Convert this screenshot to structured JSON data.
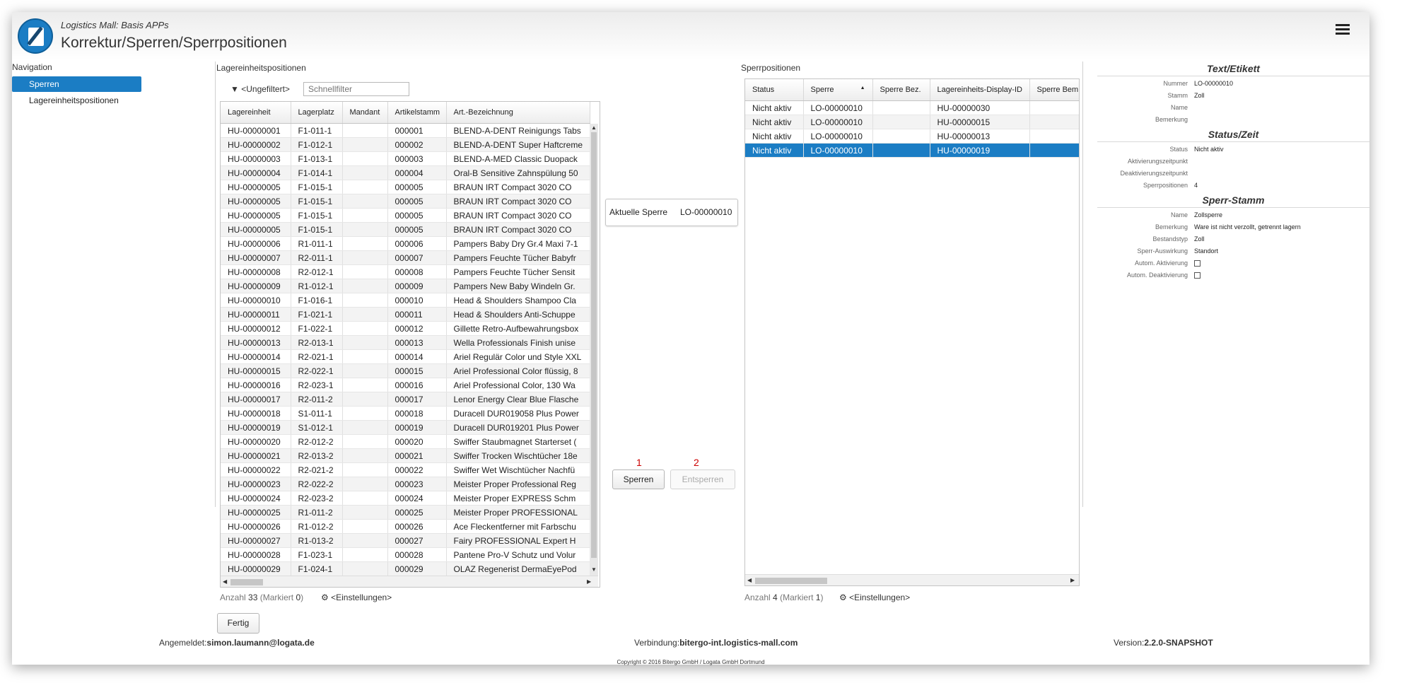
{
  "header": {
    "app_name": "Logistics Mall: Basis APPs",
    "page_title": "Korrektur/Sperren/Sperrpositionen"
  },
  "navigation": {
    "label": "Navigation",
    "items": [
      {
        "label": "Sperren",
        "active": true
      },
      {
        "label": "Lagereinheitspositionen",
        "active": false
      }
    ]
  },
  "left_panel": {
    "title": "Lagereinheitspositionen",
    "filter_label": "<Ungefiltert>",
    "quickfilter_placeholder": "Schnellfilter",
    "columns": [
      "Lagereinheit",
      "Lagerplatz",
      "Mandant",
      "Artikelstamm",
      "Art.-Bezeichnung"
    ],
    "rows": [
      [
        "HU-00000001",
        "F1-011-1",
        "",
        "000001",
        "BLEND-A-DENT Reinigungs Tabs"
      ],
      [
        "HU-00000002",
        "F1-012-1",
        "",
        "000002",
        "BLEND-A-DENT Super Haftcreme"
      ],
      [
        "HU-00000003",
        "F1-013-1",
        "",
        "000003",
        "BLEND-A-MED Classic Duopack"
      ],
      [
        "HU-00000004",
        "F1-014-1",
        "",
        "000004",
        "Oral-B Sensitive Zahnspülung 50"
      ],
      [
        "HU-00000005",
        "F1-015-1",
        "",
        "000005",
        "BRAUN IRT Compact 3020 CO"
      ],
      [
        "HU-00000005",
        "F1-015-1",
        "",
        "000005",
        "BRAUN IRT Compact 3020 CO"
      ],
      [
        "HU-00000005",
        "F1-015-1",
        "",
        "000005",
        "BRAUN IRT Compact 3020 CO"
      ],
      [
        "HU-00000005",
        "F1-015-1",
        "",
        "000005",
        "BRAUN IRT Compact 3020 CO"
      ],
      [
        "HU-00000006",
        "R1-011-1",
        "",
        "000006",
        "Pampers Baby Dry Gr.4 Maxi 7-1"
      ],
      [
        "HU-00000007",
        "R2-011-1",
        "",
        "000007",
        "Pampers Feuchte Tücher Babyfr"
      ],
      [
        "HU-00000008",
        "R2-012-1",
        "",
        "000008",
        "Pampers Feuchte Tücher Sensit"
      ],
      [
        "HU-00000009",
        "R1-012-1",
        "",
        "000009",
        "Pampers New Baby Windeln Gr."
      ],
      [
        "HU-00000010",
        "F1-016-1",
        "",
        "000010",
        "Head & Shoulders Shampoo Cla"
      ],
      [
        "HU-00000011",
        "F1-021-1",
        "",
        "000011",
        "Head & Shoulders Anti-Schuppe"
      ],
      [
        "HU-00000012",
        "F1-022-1",
        "",
        "000012",
        "Gillette Retro-Aufbewahrungsbox"
      ],
      [
        "HU-00000013",
        "R2-013-1",
        "",
        "000013",
        "Wella Professionals Finish unise"
      ],
      [
        "HU-00000014",
        "R2-021-1",
        "",
        "000014",
        "Ariel Regulär Color und Style XXL"
      ],
      [
        "HU-00000015",
        "R2-022-1",
        "",
        "000015",
        "Ariel Professional Color flüssig, 8"
      ],
      [
        "HU-00000016",
        "R2-023-1",
        "",
        "000016",
        "Ariel Professional Color, 130 Wa"
      ],
      [
        "HU-00000017",
        "R2-011-2",
        "",
        "000017",
        "Lenor Energy Clear Blue Flasche"
      ],
      [
        "HU-00000018",
        "S1-011-1",
        "",
        "000018",
        "Duracell DUR019058 Plus Power"
      ],
      [
        "HU-00000019",
        "S1-012-1",
        "",
        "000019",
        "Duracell DUR019201 Plus Power"
      ],
      [
        "HU-00000020",
        "R2-012-2",
        "",
        "000020",
        "Swiffer Staubmagnet Starterset ("
      ],
      [
        "HU-00000021",
        "R2-013-2",
        "",
        "000021",
        "Swiffer Trocken Wischtücher 18e"
      ],
      [
        "HU-00000022",
        "R2-021-2",
        "",
        "000022",
        "Swiffer Wet Wischtücher Nachfü"
      ],
      [
        "HU-00000023",
        "R2-022-2",
        "",
        "000023",
        "Meister Proper Professional Reg"
      ],
      [
        "HU-00000024",
        "R2-023-2",
        "",
        "000024",
        "Meister Proper EXPRESS Schm"
      ],
      [
        "HU-00000025",
        "R1-011-2",
        "",
        "000025",
        "Meister Proper PROFESSIONAL"
      ],
      [
        "HU-00000026",
        "R1-012-2",
        "",
        "000026",
        "Ace Fleckentferner mit Farbschu"
      ],
      [
        "HU-00000027",
        "R1-013-2",
        "",
        "000027",
        "Fairy PROFESSIONAL Expert H"
      ],
      [
        "HU-00000028",
        "F1-023-1",
        "",
        "000028",
        "Pantene Pro-V Schutz und Volur"
      ],
      [
        "HU-00000029",
        "F1-024-1",
        "",
        "000029",
        "OLAZ Regenerist DermaEyePod"
      ]
    ],
    "summary": {
      "count_label": "Anzahl",
      "count": "33",
      "marked_label": "(Markiert",
      "marked": "0",
      "close": ")"
    },
    "settings_label": "<Einstellungen>"
  },
  "middle": {
    "current_label": "Aktuelle Sperre",
    "current_value": "LO-00000010",
    "lock_number": "1",
    "unlock_number": "2",
    "lock_button": "Sperren",
    "unlock_button": "Entsperren"
  },
  "right_panel": {
    "title": "Sperrpositionen",
    "columns": [
      "Status",
      "Sperre",
      "Sperre Bez.",
      "Lagereinheits-Display-ID",
      "Sperre Bem."
    ],
    "sort_indicator": "▲",
    "rows": [
      [
        "Nicht aktiv",
        "LO-00000010",
        "",
        "HU-00000030",
        ""
      ],
      [
        "Nicht aktiv",
        "LO-00000010",
        "",
        "HU-00000015",
        ""
      ],
      [
        "Nicht aktiv",
        "LO-00000010",
        "",
        "HU-00000013",
        ""
      ],
      [
        "Nicht aktiv",
        "LO-00000010",
        "",
        "HU-00000019",
        ""
      ]
    ],
    "selected_row": 3,
    "summary": {
      "count_label": "Anzahl",
      "count": "4",
      "marked_label": "(Markiert",
      "marked": "1",
      "close": ")"
    },
    "settings_label": "<Einstellungen>"
  },
  "properties": {
    "sections": [
      {
        "title": "Text/Etikett",
        "rows": [
          {
            "k": "Nummer",
            "v": "LO-00000010"
          },
          {
            "k": "Stamm",
            "v": "Zoll"
          },
          {
            "k": "Name",
            "v": ""
          },
          {
            "k": "Bemerkung",
            "v": ""
          }
        ]
      },
      {
        "title": "Status/Zeit",
        "rows": [
          {
            "k": "Status",
            "v": "Nicht aktiv"
          },
          {
            "k": "Aktivierungszeitpunkt",
            "v": ""
          },
          {
            "k": "Deaktivierungszeitpunkt",
            "v": ""
          },
          {
            "k": "Sperrpositionen",
            "v": "4"
          }
        ]
      },
      {
        "title": "Sperr-Stamm",
        "rows": [
          {
            "k": "Name",
            "v": "Zollsperre"
          },
          {
            "k": "Bemerkung",
            "v": "Ware ist nicht verzollt, getrennt lagern"
          },
          {
            "k": "Bestandstyp",
            "v": "Zoll"
          },
          {
            "k": "Sperr-Auswirkung",
            "v": "Standort"
          },
          {
            "k": "Autom. Aktivierung",
            "v": "",
            "checkbox": true
          },
          {
            "k": "Autom. Deaktivierung",
            "v": "",
            "checkbox": true
          }
        ]
      }
    ]
  },
  "done_button": "Fertig",
  "footer": {
    "user_label": "Angemeldet:",
    "user": "simon.laumann@logata.de",
    "conn_label": "Verbindung:",
    "conn": "bitergo-int.logistics-mall.com",
    "version_label": "Version:",
    "version": "2.2.0-SNAPSHOT",
    "copyright": "Copyright © 2016 Bitergo GmbH / Logata GmbH Dortmund"
  }
}
